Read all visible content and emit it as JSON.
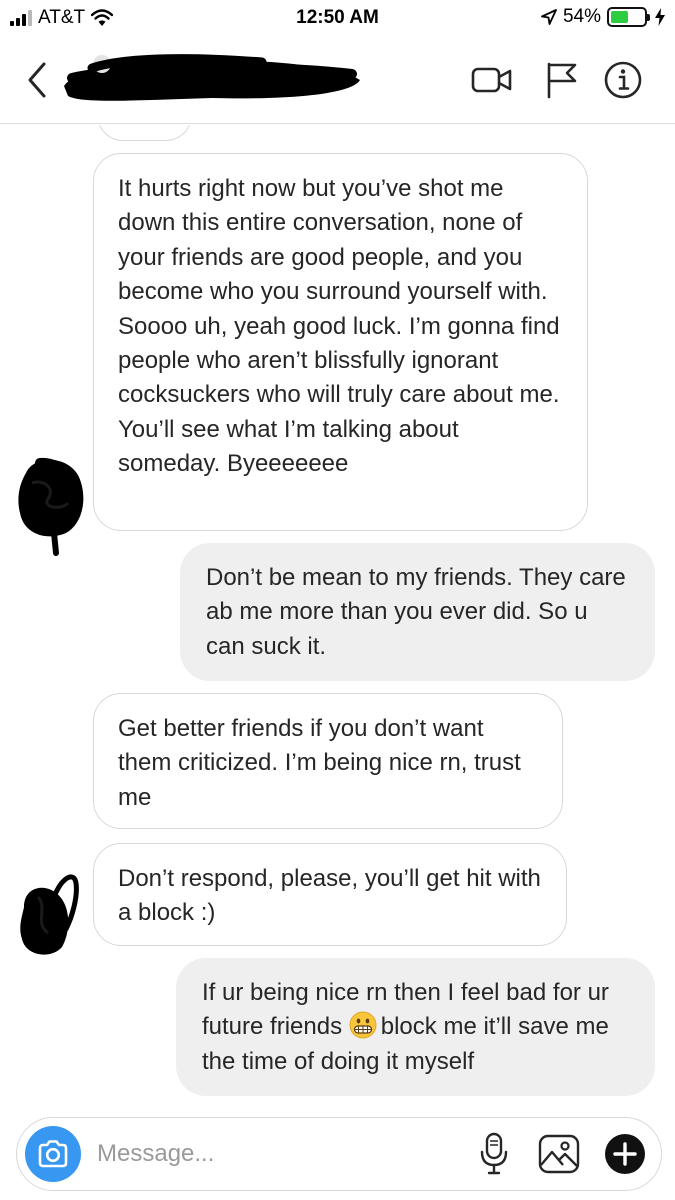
{
  "status_bar": {
    "carrier": "AT&T",
    "time": "12:50 AM",
    "battery_percent": "54%",
    "battery_level": 0.54,
    "icons": [
      "signal-icon",
      "wifi-icon",
      "location-arrow-icon",
      "battery-icon",
      "charging-bolt-icon"
    ]
  },
  "header": {
    "contact_name": "",
    "icons": [
      "back-chevron-icon",
      "video-call-icon",
      "flag-icon",
      "info-icon"
    ]
  },
  "messages": [
    {
      "id": "m1",
      "direction": "incoming",
      "text": "It hurts right now but you’ve shot me down this entire conversation, none of your friends are good people, and you become who you surround yourself with. Soooo uh, yeah good luck. I’m gonna find people who aren’t blissfully ignorant cocksuckers who will truly care about me. You’ll see what I’m talking about someday. Byeeeeeee"
    },
    {
      "id": "m2",
      "direction": "outgoing",
      "text": "Don’t be mean to my friends. They care ab me more than you ever did. So u can suck it."
    },
    {
      "id": "m3",
      "direction": "incoming",
      "text": "Get better friends if you don’t want them criticized. I’m being nice rn, trust me"
    },
    {
      "id": "m4",
      "direction": "incoming",
      "text": "Don’t respond, please, you’ll get hit with a block :)"
    },
    {
      "id": "m5",
      "direction": "outgoing",
      "text_before_emoji": "If ur being nice rn then I feel bad for ur future friends ",
      "emoji": "grimacing-face-emoji",
      "text_after_emoji": "block me it’ll save me the time of doing it myself"
    }
  ],
  "composer": {
    "placeholder": "Message...",
    "value": "",
    "icons": [
      "camera-icon",
      "microphone-icon",
      "gallery-icon",
      "plus-icon"
    ]
  },
  "colors": {
    "accent_blue": "#3897f0",
    "outgoing_bubble": "#efefef",
    "incoming_border": "#d8d8d8",
    "battery_green": "#2ecc40",
    "redaction": "#000000"
  }
}
